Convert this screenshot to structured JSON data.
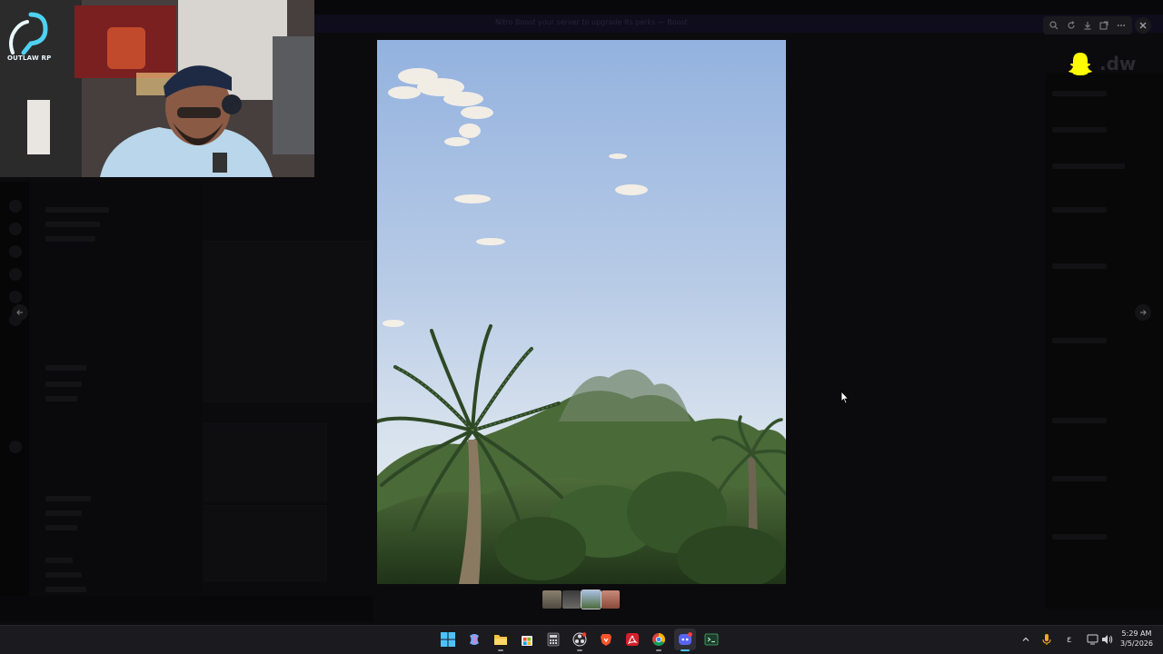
{
  "stream": {
    "logo_text": "OUTLAW RP",
    "snap_handle": ".dw"
  },
  "background_app": {
    "banner_text": "Nitro Boost your server to upgrade its perks — Boost",
    "dimmed": true
  },
  "viewer": {
    "tools": [
      "zoom-icon",
      "rotate-icon",
      "download-icon",
      "open-external-icon",
      "more-icon"
    ],
    "close_icon": "close-icon",
    "prev_icon": "arrow-left-icon",
    "next_icon": "arrow-right-icon",
    "image_description": "Palm trees and green foliage under a pale blue sky with scattered clouds",
    "thumbnail_count": 4,
    "active_thumbnail": 3
  },
  "taskbar": {
    "apps": [
      "windows-start-icon",
      "copilot-icon",
      "file-explorer-icon",
      "microsoft-store-icon",
      "calculator-icon",
      "obs-icon",
      "brave-icon",
      "adobe-acrobat-icon",
      "chrome-icon",
      "discord-icon",
      "terminal-icon"
    ],
    "active_app": "discord-icon",
    "tray": {
      "chevron": "^",
      "language": "ε"
    },
    "clock": {
      "time": "5:29 AM",
      "date": "3/5/2026"
    }
  },
  "colors": {
    "sky_top": "#9fb9e0",
    "sky_bottom": "#dfe7ef",
    "foliage": "#3b5a2c",
    "taskbar": "#1b1b1f",
    "discord_blurple": "#5865f2",
    "snap_yellow": "#fffc00",
    "logo_cyan": "#4fd1f0"
  }
}
